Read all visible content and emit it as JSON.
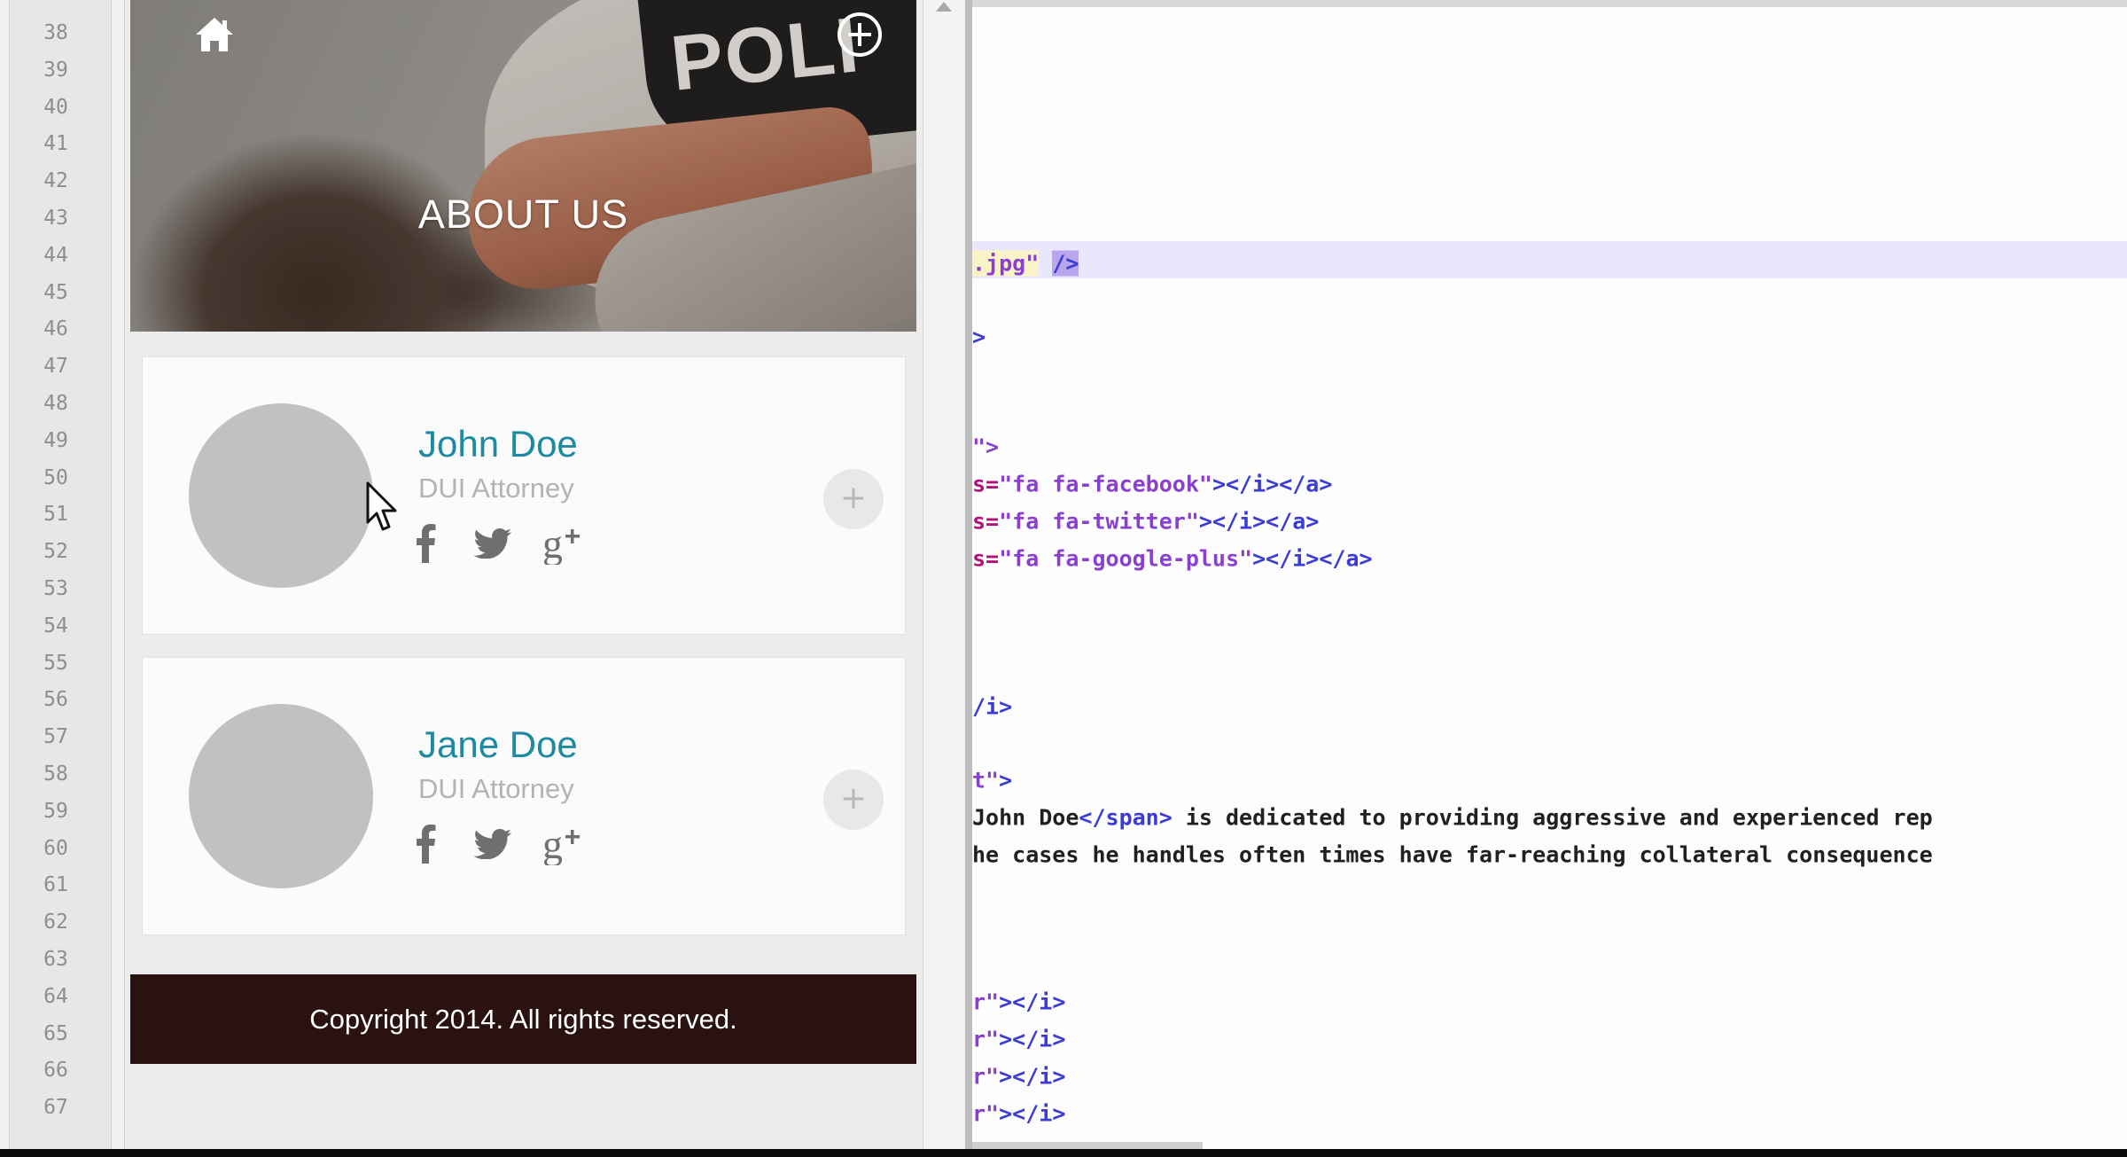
{
  "gutter": {
    "line_numbers": [
      "38",
      "39",
      "40",
      "41",
      "42",
      "43",
      "44",
      "45",
      "46",
      "47",
      "48",
      "49",
      "50",
      "51",
      "52",
      "53",
      "54",
      "55",
      "56",
      "57",
      "58",
      "59",
      "60",
      "61",
      "62",
      "63",
      "64",
      "65",
      "66",
      "67"
    ]
  },
  "preview": {
    "hero": {
      "title": "ABOUT US",
      "photo_text": "POLI",
      "home_icon": "home-icon",
      "add_icon": "plus-circle-icon"
    },
    "cards": [
      {
        "name": "John Doe",
        "role": "DUI Attorney",
        "social": [
          "facebook-icon",
          "twitter-icon",
          "google-plus-icon"
        ],
        "add_label": "+"
      },
      {
        "name": "Jane Doe",
        "role": "DUI Attorney",
        "social": [
          "facebook-icon",
          "twitter-icon",
          "google-plus-icon"
        ],
        "add_label": "+"
      }
    ],
    "footer": "Copyright 2014. All rights reserved."
  },
  "editor": {
    "lines": {
      "l44_str": ".jpg\"",
      "l44_sel": "/>",
      "l46": ">",
      "l49": "\">",
      "l50_attr": "s=",
      "l50_str": "\"fa fa-facebook\"",
      "l50_tag": "></i></a>",
      "l51_attr": "s=",
      "l51_str": "\"fa fa-twitter\"",
      "l51_tag": "></i></a>",
      "l52_attr": "s=",
      "l52_str": "\"fa fa-google-plus\"",
      "l52_tag": "></i></a>",
      "l56": "/i>",
      "l58_str": "t\"",
      "l58_tag": ">",
      "l59_txt1": "John Doe",
      "l59_tag": "</span>",
      "l59_txt2": " is dedicated to providing aggressive and experienced rep",
      "l60": "he cases he handles often times have far-reaching collateral consequence",
      "l64_str": "r\"",
      "l64_tag": "></i>",
      "l65_str": "r\"",
      "l65_tag": "></i>",
      "l66_str": "r\"",
      "l66_tag": "></i>",
      "l67_str": "r\"",
      "l67_tag": "></i>"
    }
  },
  "colors": {
    "accent": "#1d8aa2",
    "footer_bg": "#2a1210",
    "avatar": "#c1c1c1"
  }
}
